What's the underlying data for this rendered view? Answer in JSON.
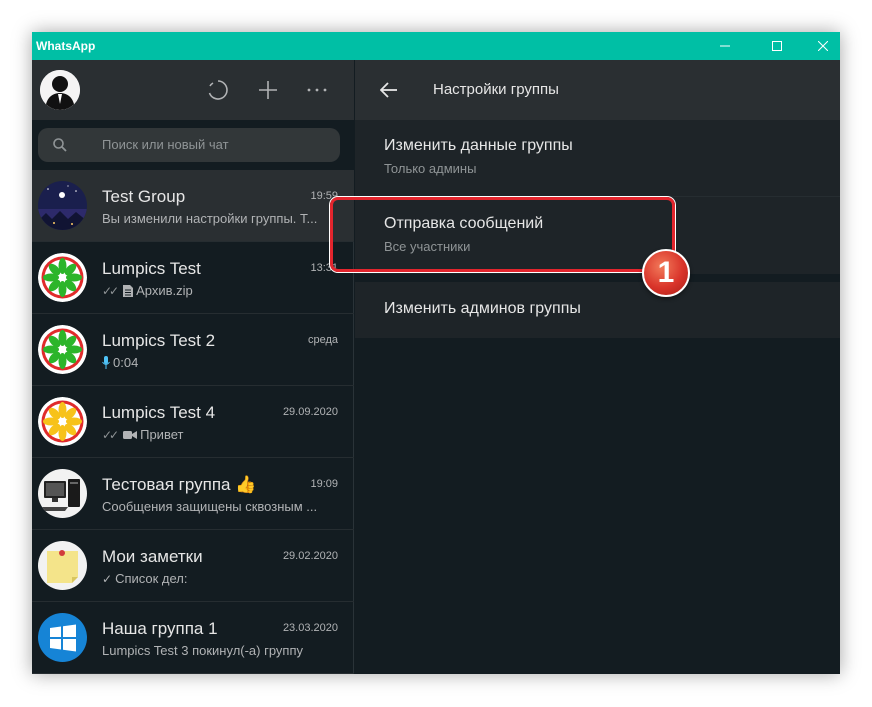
{
  "window": {
    "title": "WhatsApp"
  },
  "colors": {
    "accent": "#00bfa5",
    "background": "#131c21",
    "panel": "#2a2f32",
    "highlight": "#e3252d"
  },
  "left": {
    "search_placeholder": "Поиск или новый чат",
    "header_icons": [
      "status-icon",
      "new-chat-icon",
      "menu-icon"
    ],
    "chats": [
      {
        "name": "Test Group",
        "time": "19:59",
        "preview": "Вы изменили настройки группы. Т...",
        "icon": "night-sky-avatar"
      },
      {
        "name": "Lumpics Test",
        "time": "13:31",
        "preview": "Архив.zip",
        "icon": "lime-avatar"
      },
      {
        "name": "Lumpics Test 2",
        "time": "среда",
        "preview": "0:04",
        "icon": "lime-avatar"
      },
      {
        "name": "Lumpics Test 4",
        "time": "29.09.2020",
        "preview": "Привет",
        "icon": "orange-avatar"
      },
      {
        "name": "Тестовая группа 👍",
        "time": "19:09",
        "preview": "Сообщения защищены сквозным ...",
        "icon": "computer-avatar"
      },
      {
        "name": "Мои заметки",
        "time": "29.02.2020",
        "preview": "Список дел:",
        "icon": "sticky-note-avatar"
      },
      {
        "name": "Наша группа 1",
        "time": "23.03.2020",
        "preview": "Lumpics Test 3 покинул(-а) группу",
        "icon": "windows-avatar"
      }
    ]
  },
  "right": {
    "title": "Настройки группы",
    "settings": [
      {
        "title": "Изменить данные группы",
        "subtitle": "Только админы"
      },
      {
        "title": "Отправка сообщений",
        "subtitle": "Все участники"
      },
      {
        "title": "Изменить админов группы"
      }
    ]
  },
  "annotation": {
    "step": "1"
  }
}
